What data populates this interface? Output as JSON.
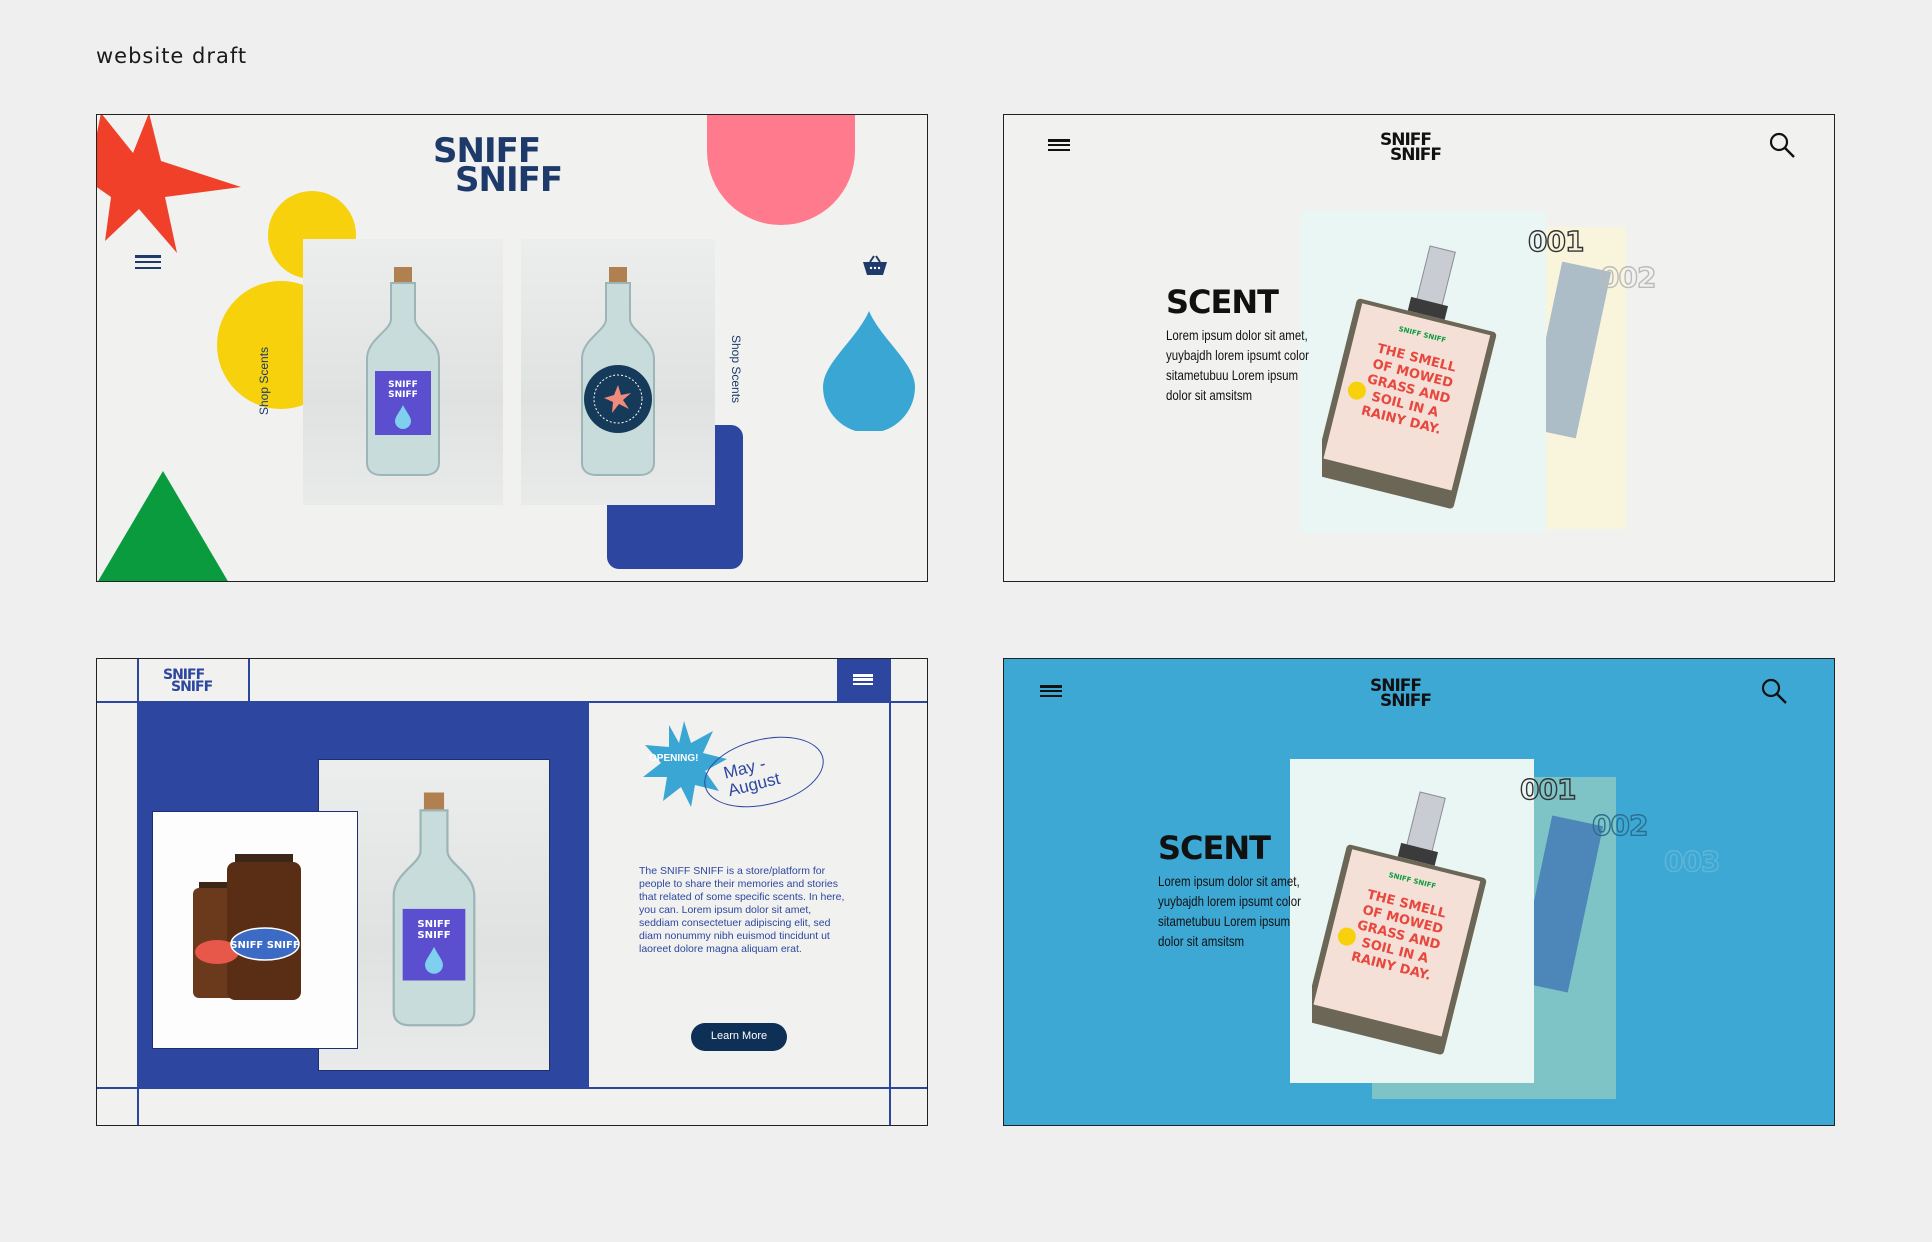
{
  "page_label": "website draft",
  "brand": {
    "line1": "SNIFF",
    "line2": "SNIFF"
  },
  "panel1": {
    "shop_left": "Shop Scents",
    "shop_right": "Shop Scents",
    "colors": {
      "red": "#f0402a",
      "yellow": "#f7d10c",
      "pink": "#ff7a8c",
      "blue_drop": "#3aa6d4",
      "navy": "#2d47a0",
      "green": "#0a9b3f"
    }
  },
  "scent_panel": {
    "title": "SCENT",
    "text_a": "Lorem ipsum dolor sit amet, yuybajdh lorem ipsumt color sitametubuu Lorem ipsum dolor sit amsitsm",
    "text_b": "Lorem ipsum dolor sit amet, yuybajdh lorem ipsumt color sitametubuu Lorem ipsum dolor sit amsitsm",
    "num1": "001",
    "num2": "002",
    "num3": "003",
    "label_text": "THE SMELL OF MOWED GRASS AND SOIL IN A RAINY DAY."
  },
  "panel3": {
    "badge": "OPENING!",
    "months": "May - August",
    "body": "The SNIFF SNIFF is a store/platform for people to share their memories and stories that related of some specific scents. In here, you can. Lorem ipsum dolor sit amet, seddiam consectetuer adipiscing elit, sed diam nonummy nibh euismod tincidunt ut laoreet dolore magna aliquam erat.",
    "button": "Learn More",
    "jar_label": "SNIFF SNIFF"
  }
}
